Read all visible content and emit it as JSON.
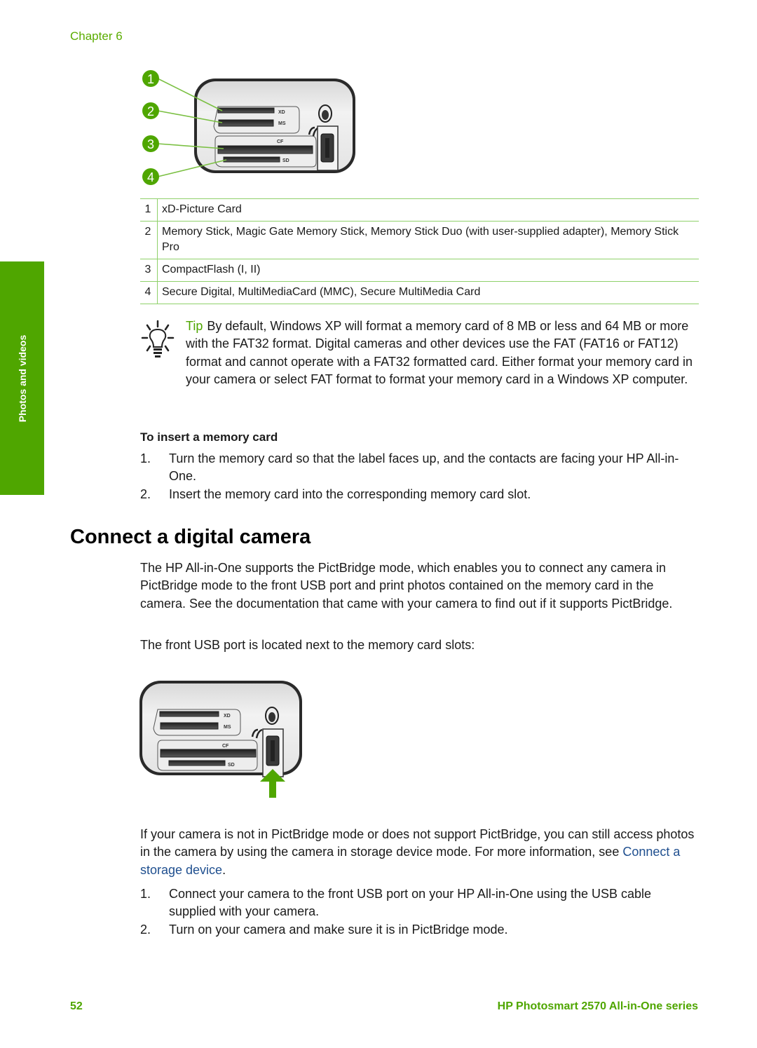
{
  "header": {
    "chapter": "Chapter 6"
  },
  "side_tab": {
    "label": "Photos and videos",
    "color": "#4fa600"
  },
  "figure1": {
    "callouts": [
      "1",
      "2",
      "3",
      "4"
    ],
    "slot_labels": [
      "XD",
      "MS",
      "CF",
      "SD"
    ]
  },
  "legend_table": {
    "rows": [
      {
        "num": "1",
        "text": "xD-Picture Card"
      },
      {
        "num": "2",
        "text": "Memory Stick, Magic Gate Memory Stick, Memory Stick Duo (with user-supplied adapter), Memory Stick Pro"
      },
      {
        "num": "3",
        "text": "CompactFlash (I, II)"
      },
      {
        "num": "4",
        "text": "Secure Digital, MultiMediaCard (MMC), Secure MultiMedia Card"
      }
    ]
  },
  "tip": {
    "label": "Tip",
    "text": "By default, Windows XP will format a memory card of 8 MB or less and 64 MB or more with the FAT32 format. Digital cameras and other devices use the FAT (FAT16 or FAT12) format and cannot operate with a FAT32 formatted card. Either format your memory card in your camera or select FAT format to format your memory card in a Windows XP computer."
  },
  "insert_procedure": {
    "heading": "To insert a memory card",
    "steps": [
      {
        "num": "1.",
        "text": "Turn the memory card so that the label faces up, and the contacts are facing your HP All-in-One."
      },
      {
        "num": "2.",
        "text": "Insert the memory card into the corresponding memory card slot."
      }
    ]
  },
  "section": {
    "title": "Connect a digital camera",
    "para1": "The HP All-in-One supports the PictBridge mode, which enables you to connect any camera in PictBridge mode to the front USB port and print photos contained on the memory card in the camera. See the documentation that came with your camera to find out if it supports PictBridge.",
    "para2": "The front USB port is located next to the memory card slots:",
    "para3_before": "If your camera is not in PictBridge mode or does not support PictBridge, you can still access photos in the camera by using the camera in storage device mode. For more information, see ",
    "para3_link": "Connect a storage device",
    "para3_after": ".",
    "steps": [
      {
        "num": "1.",
        "text": "Connect your camera to the front USB port on your HP All-in-One using the USB cable supplied with your camera."
      },
      {
        "num": "2.",
        "text": "Turn on your camera and make sure it is in PictBridge mode."
      }
    ]
  },
  "figure2": {
    "slot_labels": [
      "XD",
      "MS",
      "CF",
      "SD"
    ]
  },
  "footer": {
    "page_number": "52",
    "title": "HP Photosmart 2570 All-in-One series"
  }
}
